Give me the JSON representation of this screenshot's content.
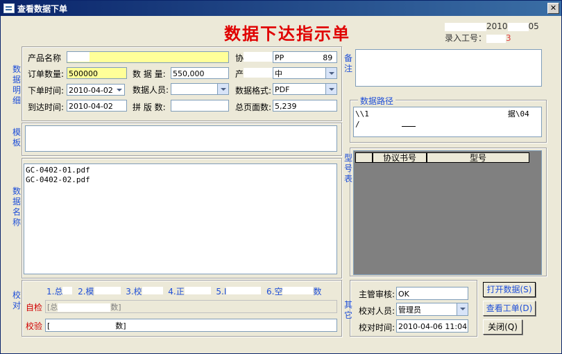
{
  "window": {
    "title": "查看数据下单",
    "close_glyph": "✕"
  },
  "header": {
    "title": "数据下达指示单",
    "date_suffix": "2010",
    "date_end": "05",
    "entry_label": "录入工号：",
    "entry_value_end": "3"
  },
  "sections": {
    "data_detail": "数据明细",
    "template": "模板",
    "data_name": "数据名称",
    "remark": "备注",
    "path": "数据路径",
    "model_table": "型号表",
    "proof": "校对",
    "other": "其它"
  },
  "form": {
    "product_name_label": "产品名称",
    "product_name_value": "",
    "agreement_label": "协",
    "agreement_value_end": "89",
    "agreement_value_mid": "PP",
    "order_qty_label": "订单数量:",
    "order_qty_value": "500000",
    "data_qty_label": "数 据 量:",
    "data_qty_value": "550,000",
    "product_type_label": "产",
    "product_type_value": "中",
    "order_time_label": "下单时间:",
    "order_time_value": "2010-04-02",
    "data_person_label": "数据人员:",
    "data_person_value": "",
    "data_format_label": "数据格式:",
    "data_format_value": "PDF",
    "arrival_time_label": "到达时间:",
    "arrival_time_value": "2010-04-02",
    "imposition_label": "拼 版 数:",
    "imposition_value": "",
    "total_pages_label": "总页面数:",
    "total_pages_value": "5,239"
  },
  "path": {
    "line1_start": "\\\\1",
    "line1_end": "据\\04",
    "line2_start": "/"
  },
  "files": [
    "GC-0402-01.pdf",
    "GC-0402-02.pdf"
  ],
  "model_table": {
    "col1": "协议书号",
    "col2": "型号"
  },
  "proof": {
    "steps": [
      "1.总",
      "2.模",
      "3.校",
      "4.正",
      "5.I",
      "6.空"
    ],
    "step_tail": "数",
    "self_check_label": "自检",
    "self_check_value": "[总",
    "self_check_end": "数]",
    "check_label": "校验",
    "check_value": "[",
    "check_end": "数]"
  },
  "other": {
    "supervisor_label": "主管审核:",
    "supervisor_value": "OK",
    "proofreader_label": "校对人员:",
    "proofreader_value": "管理员",
    "proof_time_label": "校对时间:",
    "proof_time_value": "2010-04-06 11:04:"
  },
  "buttons": {
    "open_data": "打开数据(S)",
    "view_order": "查看工单(D)",
    "close": "关闭(Q)"
  }
}
